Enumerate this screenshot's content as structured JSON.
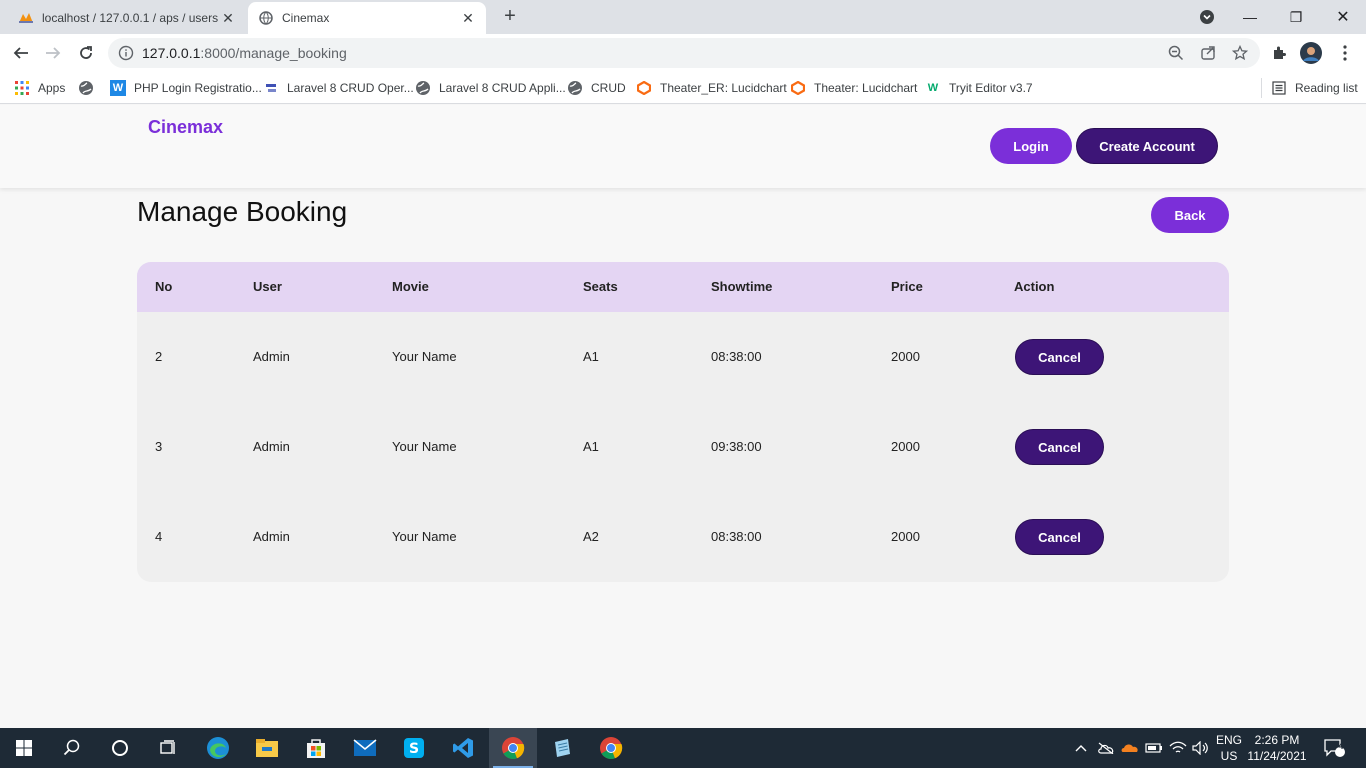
{
  "browser": {
    "tabs": [
      {
        "title": "localhost / 127.0.0.1 / aps / users |",
        "active": false
      },
      {
        "title": "Cinemax",
        "active": true
      }
    ],
    "url_host": "127.0.0.1",
    "url_path": ":8000/manage_booking",
    "bookmarks": [
      {
        "label": "Apps",
        "icon": "apps-grid-icon"
      },
      {
        "label": "",
        "icon": "globe-icon"
      },
      {
        "label": "PHP Login Registratio...",
        "icon": "w-icon"
      },
      {
        "label": "Laravel 8 CRUD Oper...",
        "icon": "site-icon"
      },
      {
        "label": "Laravel 8 CRUD Appli...",
        "icon": "globe-icon"
      },
      {
        "label": "CRUD",
        "icon": "globe-icon"
      },
      {
        "label": "Theater_ER: Lucidchart",
        "icon": "lucidchart-icon"
      },
      {
        "label": "Theater: Lucidchart",
        "icon": "lucidchart-icon"
      },
      {
        "label": "Tryit Editor v3.7",
        "icon": "w3-icon"
      }
    ],
    "reading_list": "Reading list"
  },
  "site": {
    "brand": "Cinemax",
    "login_label": "Login",
    "create_account_label": "Create Account"
  },
  "page": {
    "title": "Manage Booking",
    "back_label": "Back"
  },
  "table": {
    "headers": [
      "No",
      "User",
      "Movie",
      "Seats",
      "Showtime",
      "Price",
      "Action"
    ],
    "rows": [
      {
        "no": "2",
        "user": "Admin",
        "movie": "Your Name",
        "seats": "A1",
        "showtime": "08:38:00",
        "price": "2000",
        "action": "Cancel"
      },
      {
        "no": "3",
        "user": "Admin",
        "movie": "Your Name",
        "seats": "A1",
        "showtime": "09:38:00",
        "price": "2000",
        "action": "Cancel"
      },
      {
        "no": "4",
        "user": "Admin",
        "movie": "Your Name",
        "seats": "A2",
        "showtime": "08:38:00",
        "price": "2000",
        "action": "Cancel"
      }
    ]
  },
  "taskbar": {
    "lang_top": "ENG",
    "lang_bottom": "US",
    "time": "2:26 PM",
    "date": "11/24/2021",
    "notification_count": "4"
  },
  "colors": {
    "brand": "#7b2fd9",
    "dark_purple": "#3d1577",
    "table_header": "#e4d5f3"
  }
}
